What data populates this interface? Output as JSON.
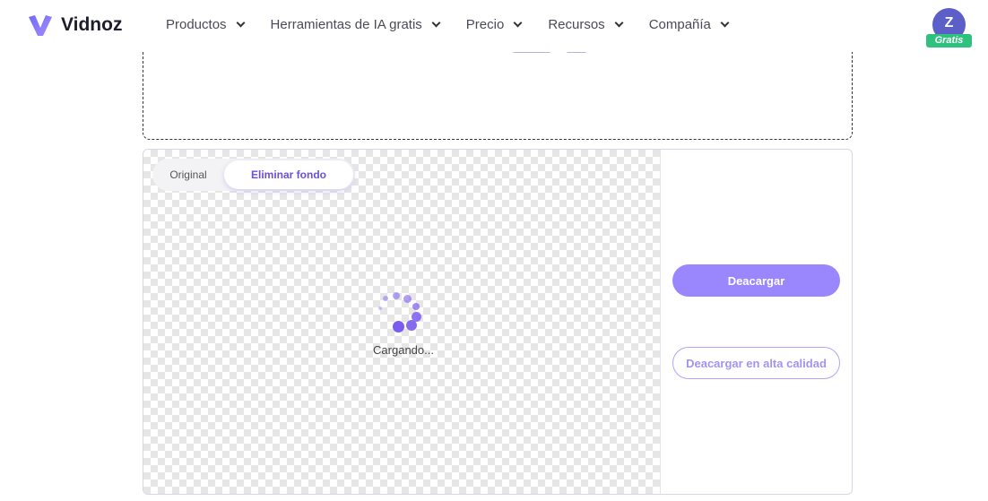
{
  "nav": {
    "brand": "Vidnoz",
    "menu": [
      {
        "label": "Productos"
      },
      {
        "label": "Herramientas de IA gratis"
      },
      {
        "label": "Precio"
      },
      {
        "label": "Recursos"
      },
      {
        "label": "Compañía"
      }
    ],
    "avatar_initial": "Z",
    "plan_badge": "Gratis"
  },
  "result": {
    "tabs": {
      "original": "Original",
      "remove_bg": "Eliminar fondo",
      "active": "remove_bg"
    },
    "loading_text": "Cargando...",
    "download_label": "Deacargar",
    "download_hq_label": "Deacargar en alta calidad"
  },
  "colors": {
    "accent": "#9b87fd",
    "accent_text": "#6a4fe0",
    "badge": "#2ec27e",
    "avatar": "#5b5fc7"
  }
}
